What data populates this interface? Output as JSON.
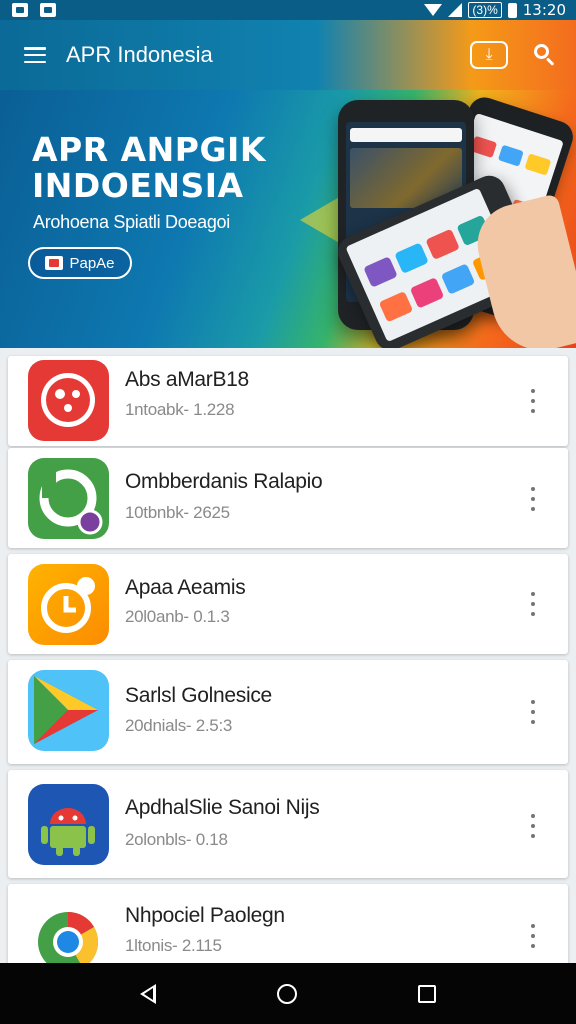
{
  "status_bar": {
    "battery_text": "(3)%",
    "time": "13:20"
  },
  "app_bar": {
    "title": "APR Indonesia",
    "icons": [
      "menu-icon",
      "install-icon",
      "search-icon"
    ]
  },
  "banner": {
    "title_line1": "APR ANPGIK",
    "title_line2": "INDOENSIA",
    "subtitle": "Arohoena Spiatli Doeagoi",
    "button_label": "PapAe"
  },
  "apps": [
    {
      "name": "Abs aMarB18",
      "meta": "1ntoabk- 1.228",
      "icon": "red-ladybug-app-icon",
      "color": "#e53935"
    },
    {
      "name": "Ombberdanis Ralapio",
      "meta": "10tbnbk- 2625",
      "icon": "green-chat-app-icon",
      "color": "#43a047"
    },
    {
      "name": "Apaa Aeamis",
      "meta": "20l0anb- 0.1.3",
      "icon": "orange-clock-app-icon",
      "color": "#ffa000"
    },
    {
      "name": "Sarlsl Golnesice",
      "meta": "20dnials- 2.5:3",
      "icon": "play-store-icon",
      "color": "#29b6f6"
    },
    {
      "name": "ApdhalSlie Sanoi Nijs",
      "meta": "2olonbls- 0.18",
      "icon": "android-robot-icon",
      "color": "#1e56b3"
    },
    {
      "name": "Nhpociel Paolegn",
      "meta": "1ltonis- 2.115",
      "icon": "chrome-browser-icon",
      "color": "#ffffff"
    }
  ],
  "nav_bar": {
    "icons": [
      "back-icon",
      "home-icon",
      "recents-icon"
    ]
  }
}
